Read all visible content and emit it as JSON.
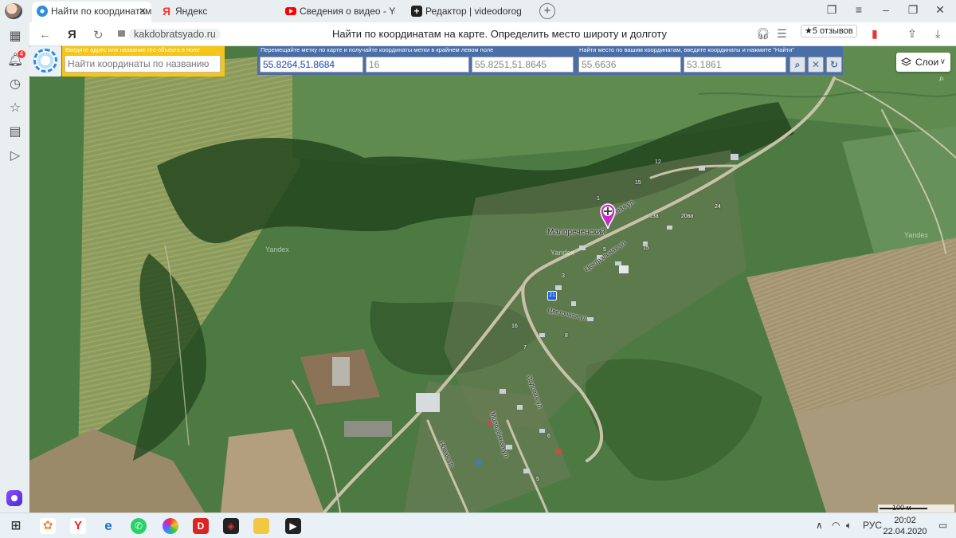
{
  "tabs": [
    {
      "title": "Найти по координатам",
      "favicon": "globe-icon",
      "active": true
    },
    {
      "title": "Яндекс",
      "favicon": "yandex-icon",
      "active": false
    },
    {
      "title": "Сведения о видео - YouTu",
      "favicon": "youtube-icon",
      "active": false
    },
    {
      "title": "Редактор | videodorogross",
      "favicon": "plus-box-icon",
      "active": false
    }
  ],
  "address_bar": {
    "yandex_glyph": "Я",
    "url": "kakdobratsyado.ru",
    "page_title": "Найти по координатам на карте. Определить место широту и долготу",
    "reviews": "★5 отзывов"
  },
  "sidebar": {
    "notification_count": "4"
  },
  "search_panel": {
    "caption": "Введите адрес или название гео объекта в поле",
    "placeholder": "Найти координаты по названию"
  },
  "coords_panel": {
    "caption": "Перемещайте метку по карте и получайте координаты метки в крайнем левом поле",
    "marker_coords": "55.8264,51.8684",
    "zoom": "16",
    "corner_coords": "55.8251,51.8645"
  },
  "find_panel": {
    "caption": "Найти место по вашим координатам, введите координаты и нажмите \"Найти\"",
    "latitude": "55.6636",
    "longitude": "53.1861"
  },
  "map": {
    "layers_label": "Слои",
    "village": "Малореченский",
    "streets": [
      "Центральная ул.",
      "Цветочная ул.",
      "Луговая ул.",
      "Садовая ул.",
      "Новая ул.",
      "Молодёжная ул."
    ],
    "road_number": "21",
    "scale": "100 м",
    "house_numbers": [
      "15",
      "15",
      "1",
      "5",
      "12",
      "13а",
      "20ва",
      "24",
      "7",
      "8",
      "3",
      "6",
      "5",
      "16"
    ],
    "watermark": "Yandex"
  },
  "taskbar": {
    "lang": "РУС",
    "time": "20:02",
    "date": "22.04.2020"
  }
}
